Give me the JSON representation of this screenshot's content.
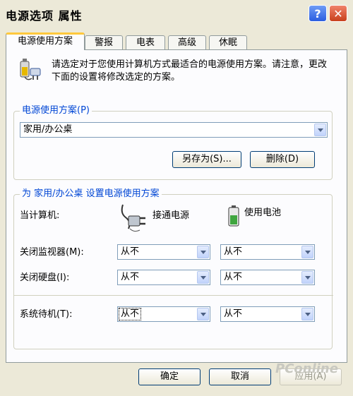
{
  "window": {
    "title": "电源选项 属性",
    "help_glyph": "?",
    "close_glyph": "✕"
  },
  "tabs": [
    {
      "label": "电源使用方案",
      "active": true
    },
    {
      "label": "警报",
      "active": false
    },
    {
      "label": "电表",
      "active": false
    },
    {
      "label": "高级",
      "active": false
    },
    {
      "label": "休眠",
      "active": false
    }
  ],
  "intro_text": "请选定对于您使用计算机方式最适合的电源使用方案。请注意，更改下面的设置将修改选定的方案。",
  "scheme_group": {
    "legend": "电源使用方案(P)",
    "selected_scheme": "家用/办公桌",
    "save_as_label": "另存为(S)...",
    "delete_label": "删除(D)"
  },
  "settings_group": {
    "legend": "为 家用/办公桌 设置电源使用方案",
    "computer_label": "当计算机:",
    "plugged_in_label": "接通电源",
    "battery_label": "使用电池",
    "rows": [
      {
        "label": "关闭监视器(M):",
        "plugged_in": "从不",
        "battery": "从不"
      },
      {
        "label": "关闭硬盘(I):",
        "plugged_in": "从不",
        "battery": "从不"
      },
      {
        "label": "系统待机(T):",
        "plugged_in": "从不",
        "battery": "从不"
      }
    ]
  },
  "footer": {
    "ok_label": "确定",
    "cancel_label": "取消",
    "apply_label": "应用(A)"
  },
  "watermark": "PConline"
}
